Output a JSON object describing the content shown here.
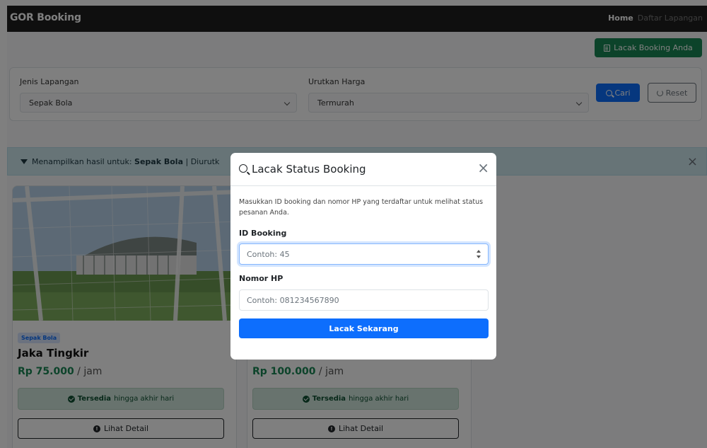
{
  "navbar": {
    "brand": "GOR Booking",
    "links": [
      "Home",
      "Daftar Lapangan"
    ]
  },
  "header": {
    "lacak_button": "Lacak Booking Anda"
  },
  "filter": {
    "jenis_label": "Jenis Lapangan",
    "jenis_value": "Sepak Bola",
    "urutkan_label": "Urutkan Harga",
    "urutkan_value": "Termurah",
    "cari_label": "Cari",
    "reset_label": "Reset"
  },
  "alert": {
    "prefix": "Menampilkan hasil untuk:",
    "category": "Sepak Bola",
    "suffix": "| Diurutk"
  },
  "cards": [
    {
      "badge": "Sepak Bola",
      "title": "Jaka Tingkir",
      "price": "Rp 75.000",
      "per": "/ jam",
      "status": "Tersedia",
      "status_suffix": "hingga akhir hari",
      "detail": "Lihat Detail"
    },
    {
      "badge": "",
      "title": "",
      "price": "Rp 100.000",
      "per": "/ jam",
      "status": "Tersedia",
      "status_suffix": "hingga akhir hari",
      "detail": "Lihat Detail"
    }
  ],
  "modal": {
    "title": "Lacak Status Booking",
    "description": "Masukkan ID booking dan nomor HP yang terdaftar untuk melihat status pesanan Anda.",
    "id_label": "ID Booking",
    "id_placeholder": "Contoh: 45",
    "hp_label": "Nomor HP",
    "hp_placeholder": "Contoh: 081234567890",
    "submit": "Lacak Sekarang"
  },
  "colors": {
    "primary": "#0d6efd",
    "success": "#198754",
    "navbar": "#1f1f1f"
  }
}
